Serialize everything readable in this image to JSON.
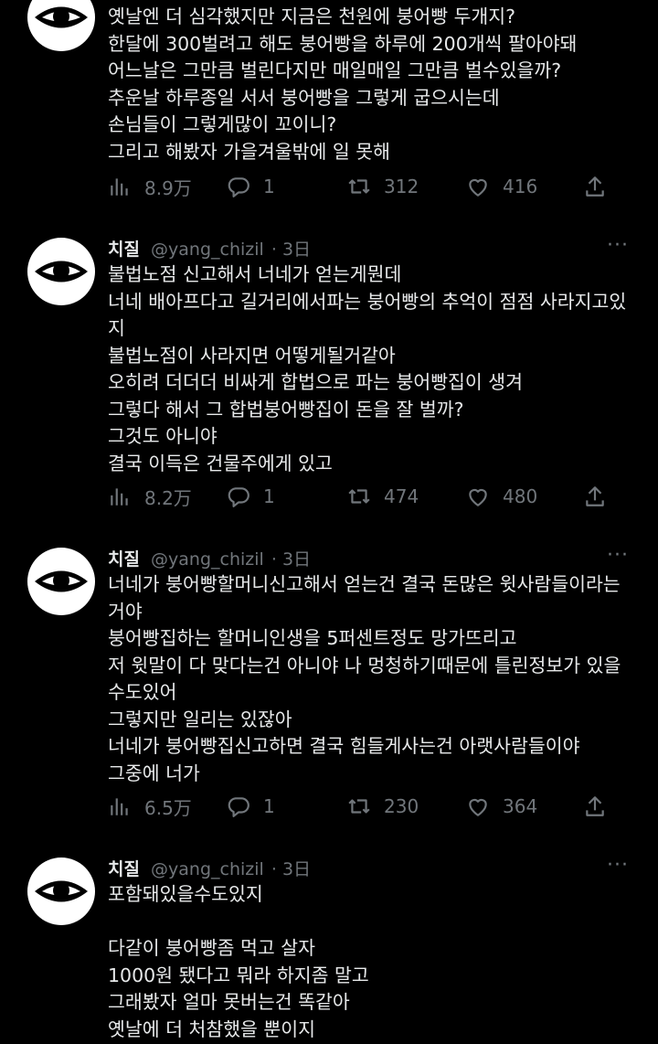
{
  "tweets": [
    {
      "lines": [
        "옛날엔 더 심각했지만 지금은 천원에 붕어빵 두개지?",
        "한달에 300벌려고 해도 붕어빵을 하루에 200개씩 팔아야돼",
        "어느날은 그만큼 벌린다지만 매일매일 그만큼 벌수있을까?",
        "추운날 하루종일 서서 붕어빵을 그렇게 굽으시는데",
        "손님들이 그렇게많이 꼬이니?",
        "그리고 해봤자 가을겨울밖에 일 못해"
      ],
      "views": "8.9万",
      "replies": "1",
      "retweets": "312",
      "likes": "416"
    },
    {
      "author": "치질",
      "handle": "@yang_chizil",
      "time": "· 3日",
      "more": "···",
      "lines": [
        "불법노점 신고해서 너네가 얻는게뭔데",
        "너네 배아프다고 길거리에서파는 붕어빵의 추억이 점점 사라지고있",
        "지",
        "불법노점이 사라지면 어떻게될거같아",
        "오히려 더더더 비싸게 합법으로 파는 붕어빵집이 생겨",
        "그렇다 해서 그 합법붕어빵집이 돈을 잘 벌까?",
        "그것도 아니야",
        "결국 이득은 건물주에게 있고"
      ],
      "views": "8.2万",
      "replies": "1",
      "retweets": "474",
      "likes": "480"
    },
    {
      "author": "치질",
      "handle": "@yang_chizil",
      "time": "· 3日",
      "more": "···",
      "lines": [
        "너네가 붕어빵할머니신고해서 얻는건 결국 돈많은 윗사람들이라는",
        "거야",
        "붕어빵집하는 할머니인생을 5퍼센트정도 망가뜨리고",
        "저 윗말이 다 맞다는건 아니야 나 멍청하기때문에 틀린정보가 있을",
        "수도있어",
        "그렇지만 일리는 있잖아",
        "너네가 붕어빵집신고하면 결국 힘들게사는건 아랫사람들이야",
        "그중에 너가"
      ],
      "views": "6.5万",
      "replies": "1",
      "retweets": "230",
      "likes": "364"
    },
    {
      "author": "치질",
      "handle": "@yang_chizil",
      "time": "· 3日",
      "more": "···",
      "lines": [
        "포함돼있을수도있지",
        "",
        "다같이 붕어빵좀 먹고 살자",
        "1000원 됐다고 뭐라 하지좀 말고",
        "그래봤자 얼마 못버는건 똑같아",
        "옛날에 더 처참했을 뿐이지"
      ]
    }
  ],
  "icons": [
    "eye-avatar",
    "views-icon",
    "reply-icon",
    "retweet-icon",
    "like-icon",
    "share-icon"
  ]
}
